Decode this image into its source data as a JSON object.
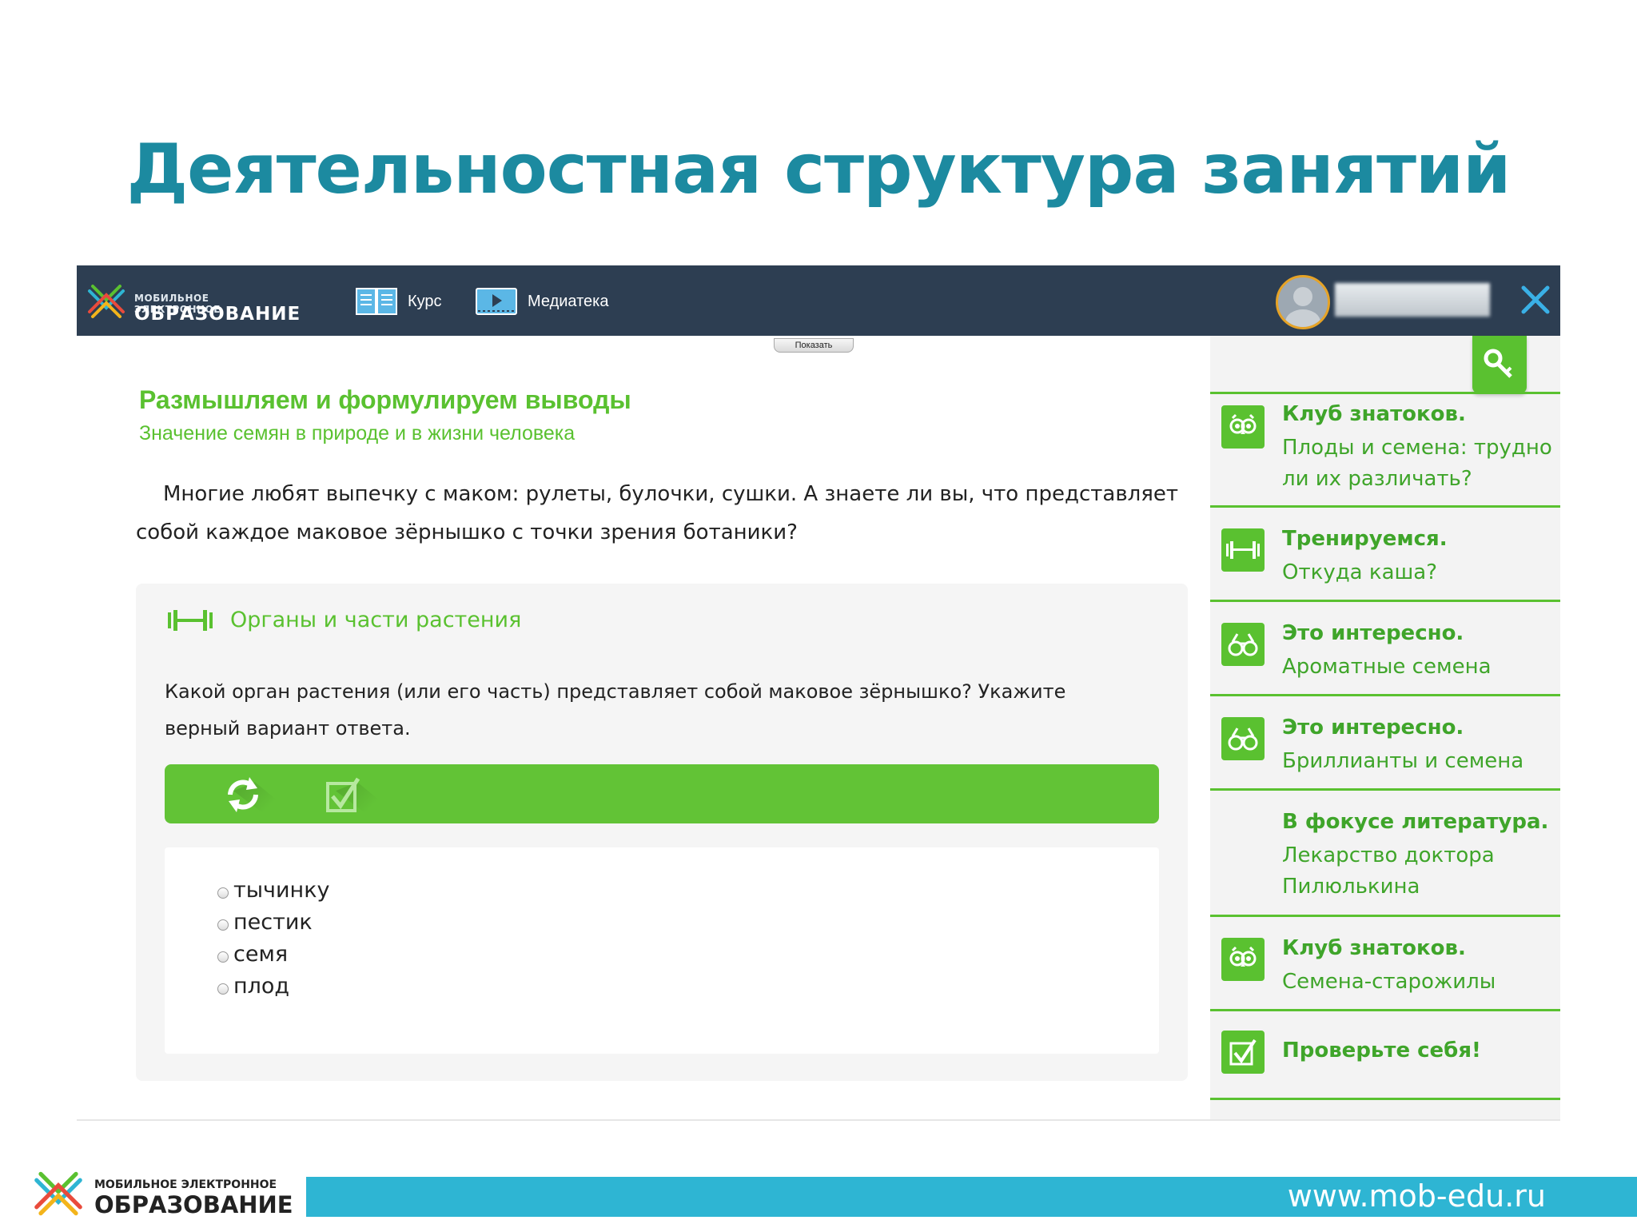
{
  "slide": {
    "title": "Деятельностная структура занятий"
  },
  "app": {
    "logo": {
      "small": "МОБИЛЬНОЕ ЭЛЕКТРОННОЕ",
      "big": "ОБРАЗОВАНИЕ"
    },
    "nav": {
      "course": "Курс",
      "media": "Медиатека"
    },
    "show_button": "Показать"
  },
  "lesson": {
    "title": "Размышляем и формулируем выводы",
    "subtitle": "Значение семян в природе и в жизни человека",
    "intro": "Многие любят выпечку с маком: рулеты, булочки, сушки. А знаете ли вы, что представляет собой каждое маковое зёрнышко с точки зрения ботаники?"
  },
  "task": {
    "heading": "Органы и части растения",
    "question": "Какой орган растения (или его часть) представляет собой маковое зёрнышко? Укажите верный вариант ответа.",
    "options": [
      "тычинку",
      "пестик",
      "семя",
      "плод"
    ]
  },
  "sidebar": {
    "items": [
      {
        "icon": "owl-icon",
        "title": "Клуб знатоков.",
        "desc": "Плоды и семена: трудно ли их различать?"
      },
      {
        "icon": "dumbbell-icon",
        "title": "Тренируемся.",
        "desc": "Откуда каша?"
      },
      {
        "icon": "binoculars-icon",
        "title": "Это интересно.",
        "desc": "Ароматные семена"
      },
      {
        "icon": "binoculars-icon",
        "title": "Это интересно.",
        "desc": "Бриллианты и семена"
      },
      {
        "icon": "",
        "title": "В фокусе литература.",
        "desc": "Лекарство доктора Пилюлькина"
      },
      {
        "icon": "owl-icon",
        "title": "Клуб знатоков.",
        "desc": "Семена-старожилы"
      },
      {
        "icon": "checkbox-icon",
        "title": "Проверьте себя!",
        "desc": ""
      }
    ]
  },
  "footer": {
    "logo_small": "МОБИЛЬНОЕ ЭЛЕКТРОННОЕ",
    "logo_big": "ОБРАЗОВАНИЕ",
    "url": "www.mob-edu.ru"
  },
  "colors": {
    "accent_green": "#5ac130",
    "topbar": "#2d3e52",
    "title_teal": "#1c8aa0",
    "footer_blue": "#2eb5d3"
  }
}
